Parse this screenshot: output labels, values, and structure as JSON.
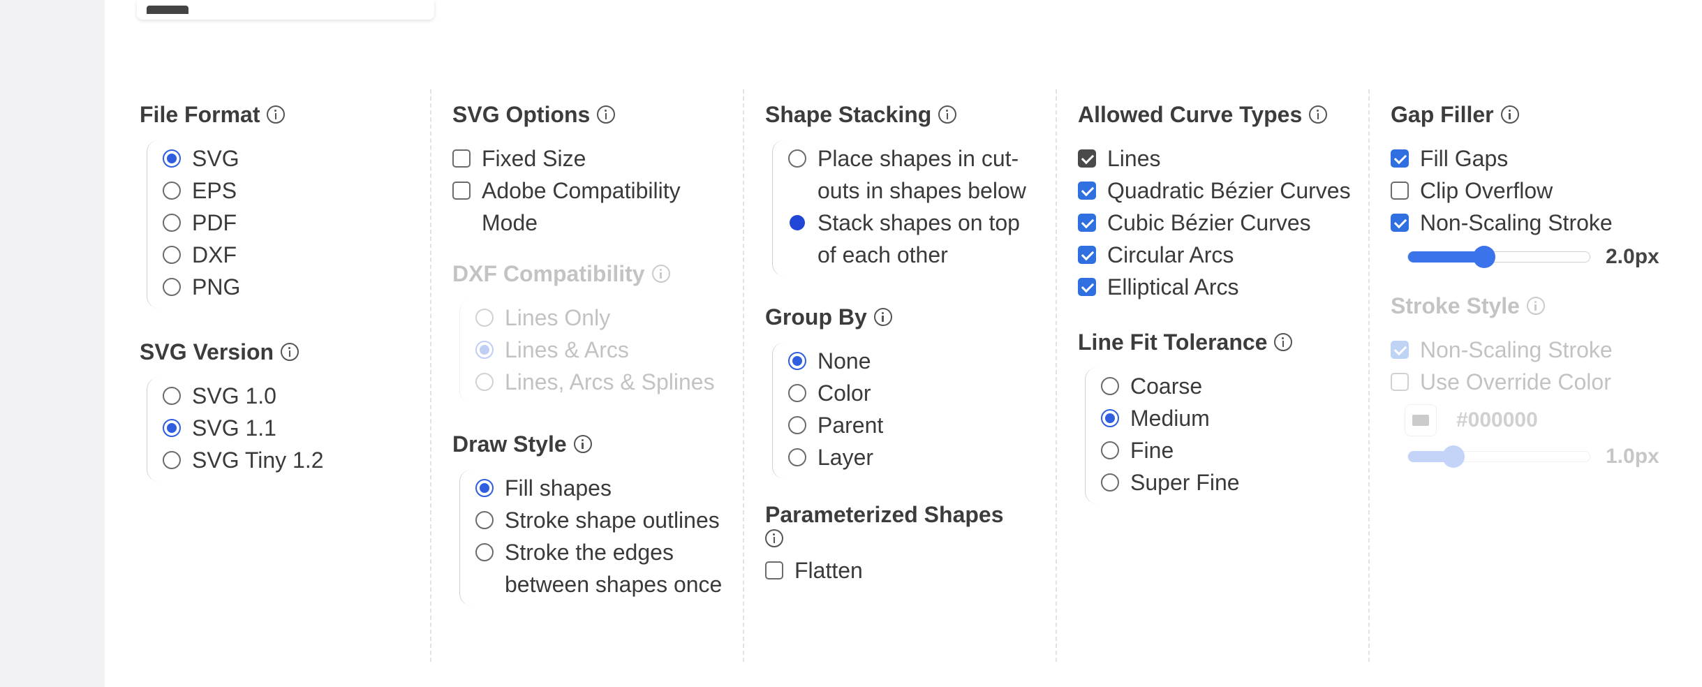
{
  "file_format": {
    "heading": "File Format",
    "options": [
      "SVG",
      "EPS",
      "PDF",
      "DXF",
      "PNG"
    ],
    "selected": "SVG"
  },
  "svg_version": {
    "heading": "SVG Version",
    "options": [
      "SVG 1.0",
      "SVG 1.1",
      "SVG Tiny 1.2"
    ],
    "selected": "SVG 1.1"
  },
  "svg_options": {
    "heading": "SVG Options",
    "options": [
      {
        "label": "Fixed Size",
        "checked": false
      },
      {
        "label": "Adobe Compatibility Mode",
        "checked": false
      }
    ]
  },
  "dxf_compatibility": {
    "heading": "DXF Compatibility",
    "disabled": true,
    "options": [
      "Lines Only",
      "Lines & Arcs",
      "Lines, Arcs & Splines"
    ],
    "selected": "Lines & Arcs"
  },
  "draw_style": {
    "heading": "Draw Style",
    "options": [
      "Fill shapes",
      "Stroke shape outlines",
      "Stroke the edges between shapes once"
    ],
    "selected": "Fill shapes"
  },
  "shape_stacking": {
    "heading": "Shape Stacking",
    "options": [
      "Place shapes in cut-outs in shapes below",
      "Stack shapes on top of each other"
    ],
    "selected": "Stack shapes on top of each other"
  },
  "group_by": {
    "heading": "Group By",
    "options": [
      "None",
      "Color",
      "Parent",
      "Layer"
    ],
    "selected": "None"
  },
  "parameterized_shapes": {
    "heading": "Parameterized Shapes",
    "options": [
      {
        "label": "Flatten",
        "checked": false
      }
    ]
  },
  "curve_types": {
    "heading": "Allowed Curve Types",
    "options": [
      {
        "label": "Lines",
        "checked": true
      },
      {
        "label": "Quadratic Bézier Curves",
        "checked": true
      },
      {
        "label": "Cubic Bézier Curves",
        "checked": true
      },
      {
        "label": "Circular Arcs",
        "checked": true
      },
      {
        "label": "Elliptical Arcs",
        "checked": true
      }
    ]
  },
  "line_fit": {
    "heading": "Line Fit Tolerance",
    "options": [
      "Coarse",
      "Medium",
      "Fine",
      "Super Fine"
    ],
    "selected": "Medium"
  },
  "gap_filler": {
    "heading": "Gap Filler",
    "options": [
      {
        "label": "Fill Gaps",
        "checked": true
      },
      {
        "label": "Clip Overflow",
        "checked": false
      },
      {
        "label": "Non-Scaling Stroke",
        "checked": true
      }
    ],
    "stroke_width": "2.0px",
    "stroke_fraction": 0.42
  },
  "stroke_style": {
    "heading": "Stroke Style",
    "disabled": true,
    "options": [
      {
        "label": "Non-Scaling Stroke",
        "checked": true
      },
      {
        "label": "Use Override Color",
        "checked": false
      }
    ],
    "override_color": "#000000",
    "stroke_width": "1.0px",
    "stroke_fraction": 0.25
  },
  "colors": {
    "accent": "#2f6fe0",
    "radio_solid": "#2146d6",
    "divider": "#e2e2e2"
  }
}
